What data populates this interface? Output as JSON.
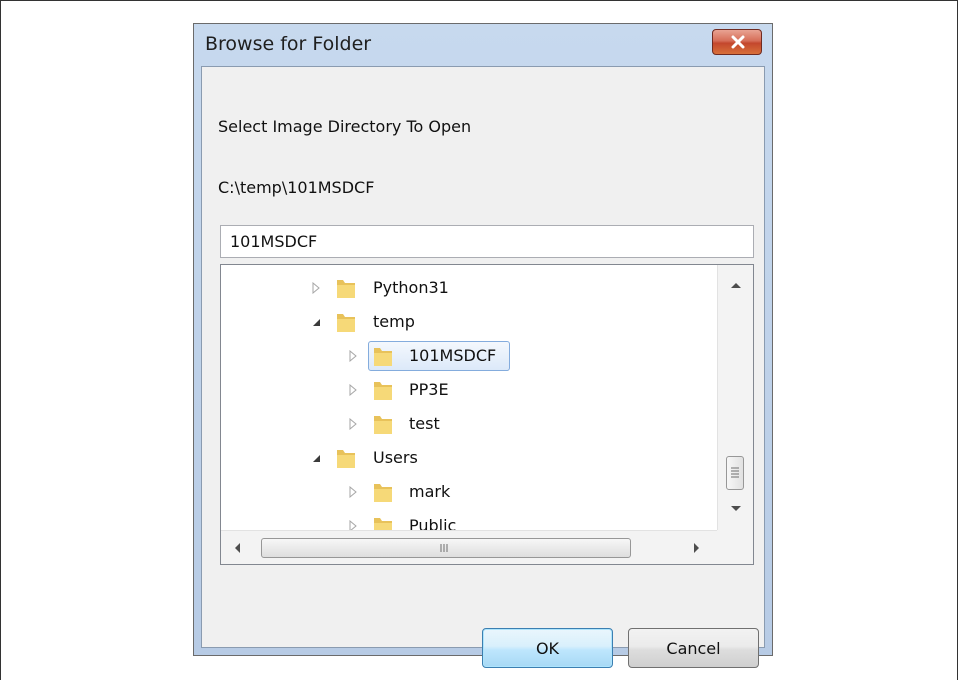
{
  "dialog": {
    "title": "Browse for Folder",
    "description": "Select Image Directory To Open",
    "current_path": "C:\\temp\\101MSDCF",
    "folder_name_value": "101MSDCF"
  },
  "tree": {
    "items": [
      {
        "label": "Python31",
        "state": "collapsed",
        "level": 1
      },
      {
        "label": "temp",
        "state": "expanded",
        "level": 1
      },
      {
        "label": "101MSDCF",
        "state": "collapsed",
        "level": 2,
        "selected": true
      },
      {
        "label": "PP3E",
        "state": "collapsed",
        "level": 2
      },
      {
        "label": "test",
        "state": "collapsed",
        "level": 2
      },
      {
        "label": "Users",
        "state": "expanded",
        "level": 1
      },
      {
        "label": "mark",
        "state": "collapsed",
        "level": 2
      },
      {
        "label": "Public",
        "state": "collapsed",
        "level": 2
      }
    ]
  },
  "buttons": {
    "ok": "OK",
    "cancel": "Cancel"
  },
  "icons": {
    "close": "close-x-icon",
    "folder": "folder-icon",
    "expander_collapsed": "triangle-right-icon",
    "expander_expanded": "triangle-down-icon"
  },
  "colors": {
    "titlebar": "#c7d9ee",
    "close_button": "#c3472d",
    "selection_border": "#84acdd",
    "ok_border": "#3c7fb1"
  }
}
